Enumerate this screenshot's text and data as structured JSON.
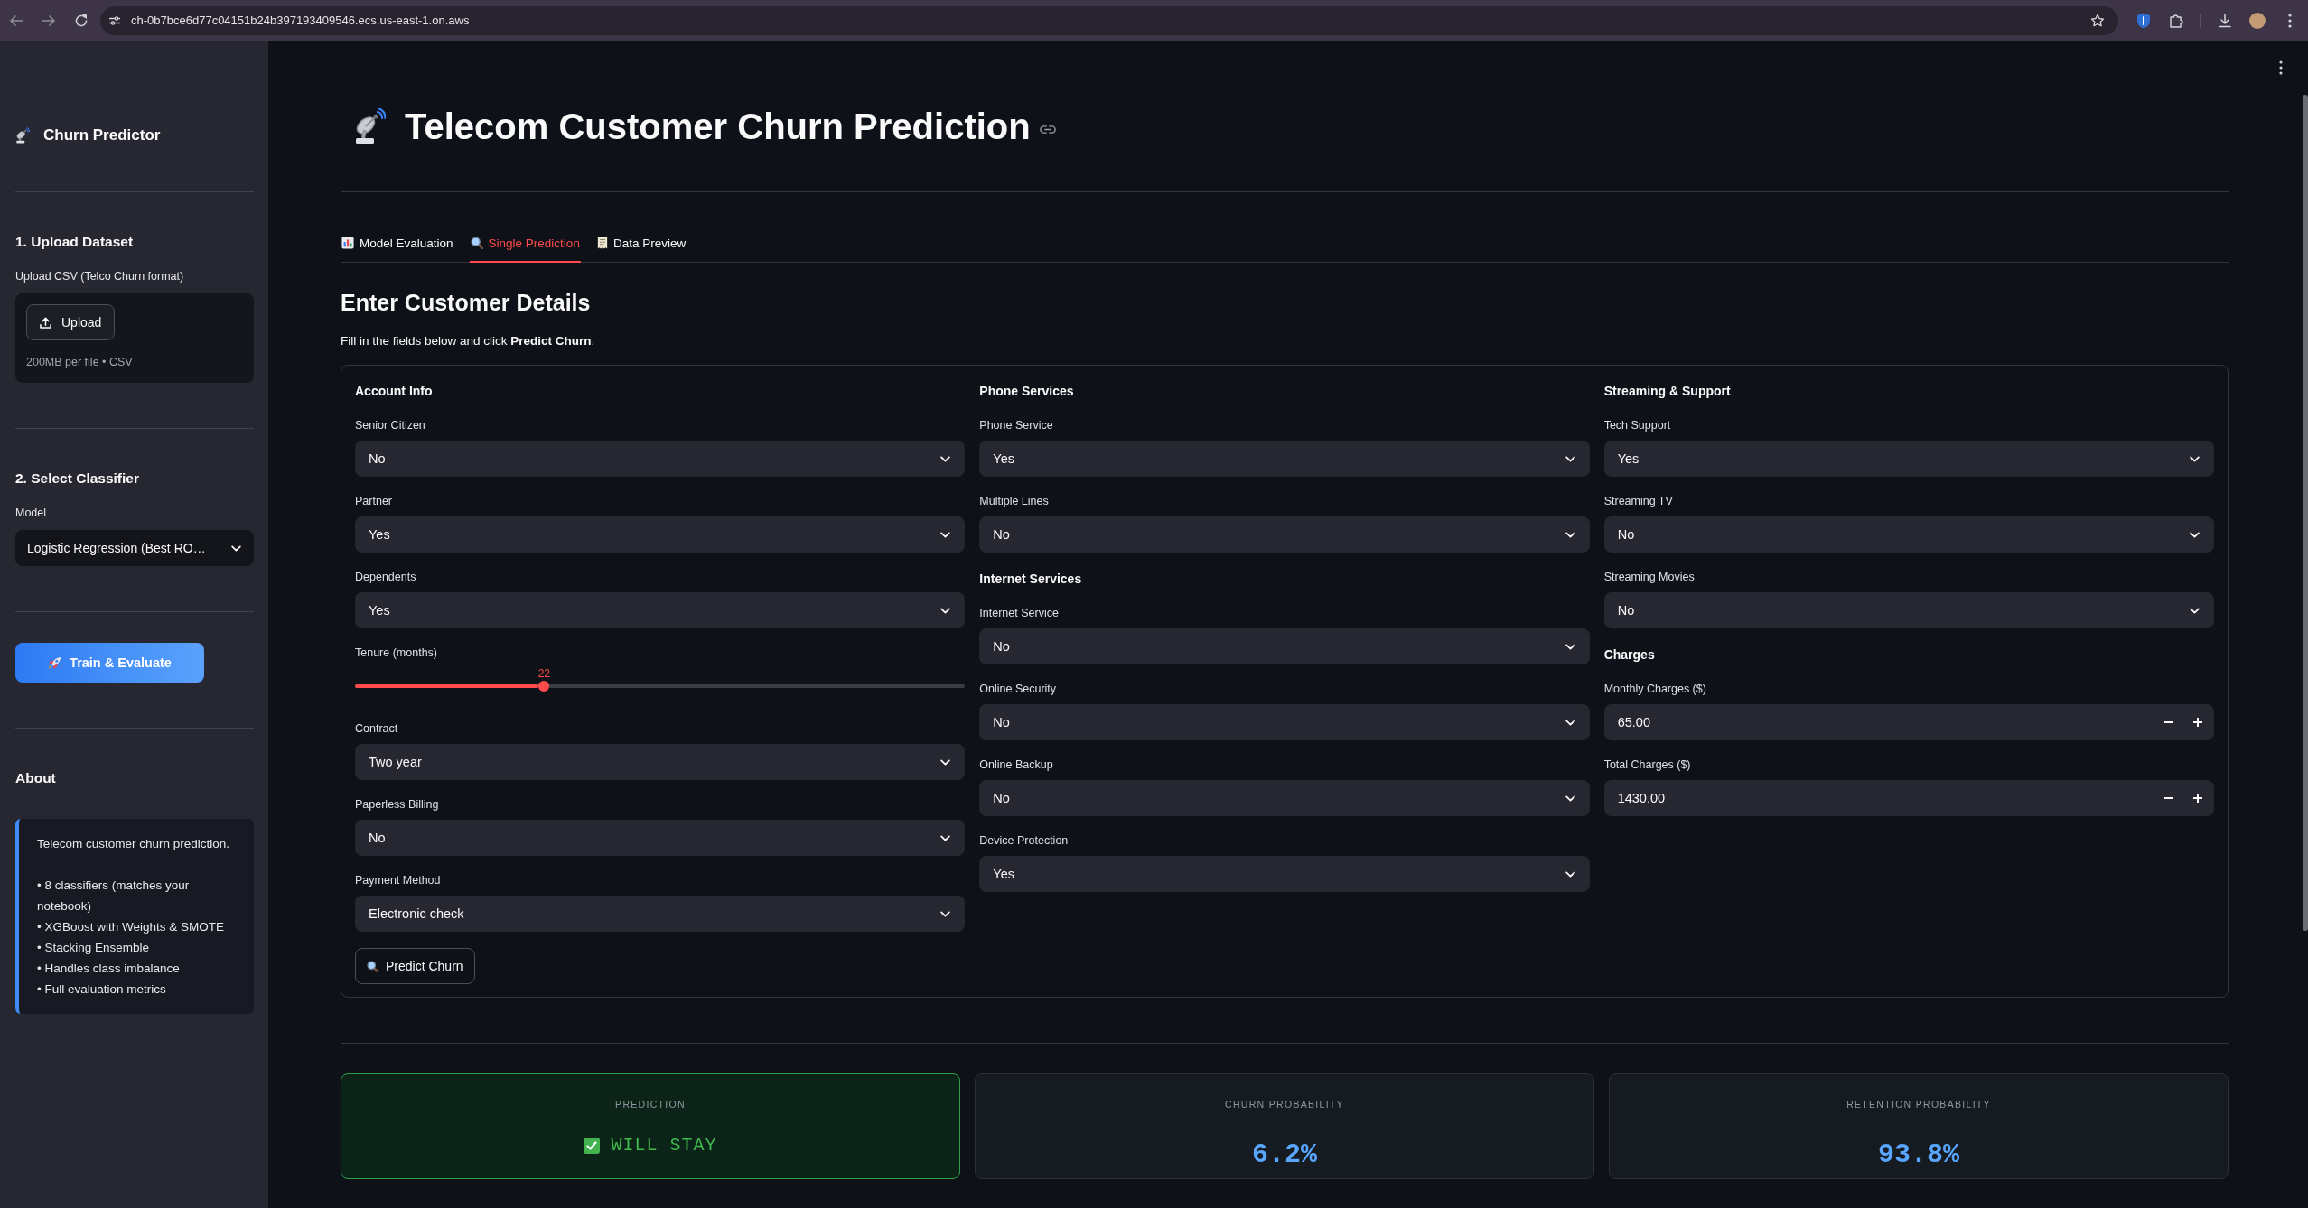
{
  "browser": {
    "url": "ch-0b7bce6d77c04151b24b397193409546.ecs.us-east-1.on.aws"
  },
  "sidebar": {
    "title": "Churn Predictor",
    "sections": [
      {
        "kind": "upload",
        "heading": "1. Upload Dataset",
        "label": "Upload CSV (Telco Churn format)",
        "button": "Upload",
        "hint": "200MB per file • CSV"
      },
      {
        "kind": "select",
        "heading": "2. Select Classifier",
        "label": "Model",
        "value": "Logistic Regression (Best RO…"
      },
      {
        "kind": "button",
        "button": "Train & Evaluate"
      },
      {
        "kind": "info",
        "heading": "About",
        "intro": "Telecom customer churn prediction.",
        "bullets": [
          "• 8 classifiers (matches your notebook)",
          "• XGBoost with Weights & SMOTE",
          "• Stacking Ensemble",
          "• Handles class imbalance",
          "• Full evaluation metrics"
        ]
      }
    ]
  },
  "page": {
    "title": "Telecom Customer Churn Prediction"
  },
  "tabs": [
    {
      "label": "Model Evaluation",
      "selected": false
    },
    {
      "label": "Single Prediction",
      "selected": true
    },
    {
      "label": "Data Preview",
      "selected": false
    }
  ],
  "form": {
    "heading": "Enter Customer Details",
    "instructions": "Fill in the fields below and click **Predict Churn**.",
    "columns": [
      {
        "items": [
          {
            "kind": "heading",
            "text": "Account Info"
          },
          {
            "kind": "select",
            "label": "Senior Citizen",
            "value": "No"
          },
          {
            "kind": "select",
            "label": "Partner",
            "value": "Yes"
          },
          {
            "kind": "select",
            "label": "Dependents",
            "value": "Yes"
          },
          {
            "kind": "slider",
            "label": "Tenure (months)",
            "value": "22",
            "level": 0.31
          },
          {
            "kind": "select",
            "label": "Contract",
            "value": "Two year"
          },
          {
            "kind": "select",
            "label": "Paperless Billing",
            "value": "No"
          },
          {
            "kind": "select",
            "label": "Payment Method",
            "value": "Electronic check"
          },
          {
            "kind": "button",
            "text": "Predict Churn"
          }
        ]
      },
      {
        "items": [
          {
            "kind": "heading",
            "text": "Phone Services"
          },
          {
            "kind": "select",
            "label": "Phone Service",
            "value": "Yes"
          },
          {
            "kind": "select",
            "label": "Multiple Lines",
            "value": "No"
          },
          {
            "kind": "heading",
            "text": "Internet Services"
          },
          {
            "kind": "select",
            "label": "Internet Service",
            "value": "No"
          },
          {
            "kind": "select",
            "label": "Online Security",
            "value": "No"
          },
          {
            "kind": "select",
            "label": "Online Backup",
            "value": "No"
          },
          {
            "kind": "select",
            "label": "Device Protection",
            "value": "Yes"
          }
        ]
      },
      {
        "items": [
          {
            "kind": "heading",
            "text": "Streaming & Support"
          },
          {
            "kind": "select",
            "label": "Tech Support",
            "value": "Yes"
          },
          {
            "kind": "select",
            "label": "Streaming TV",
            "value": "No"
          },
          {
            "kind": "select",
            "label": "Streaming Movies",
            "value": "No"
          },
          {
            "kind": "heading",
            "text": "Charges"
          },
          {
            "kind": "number",
            "label": "Monthly Charges ($)",
            "value": "65.00"
          },
          {
            "kind": "number",
            "label": "Total Charges ($)",
            "value": "1430.00"
          }
        ]
      }
    ]
  },
  "results": [
    {
      "kind": "prediction",
      "label": "PREDICTION",
      "value": "WILL STAY",
      "churn": false
    },
    {
      "kind": "metric",
      "label": "CHURN PROBABILITY",
      "value": "6.2%"
    },
    {
      "kind": "metric",
      "label": "RETENTION PROBABILITY",
      "value": "93.8%"
    }
  ]
}
